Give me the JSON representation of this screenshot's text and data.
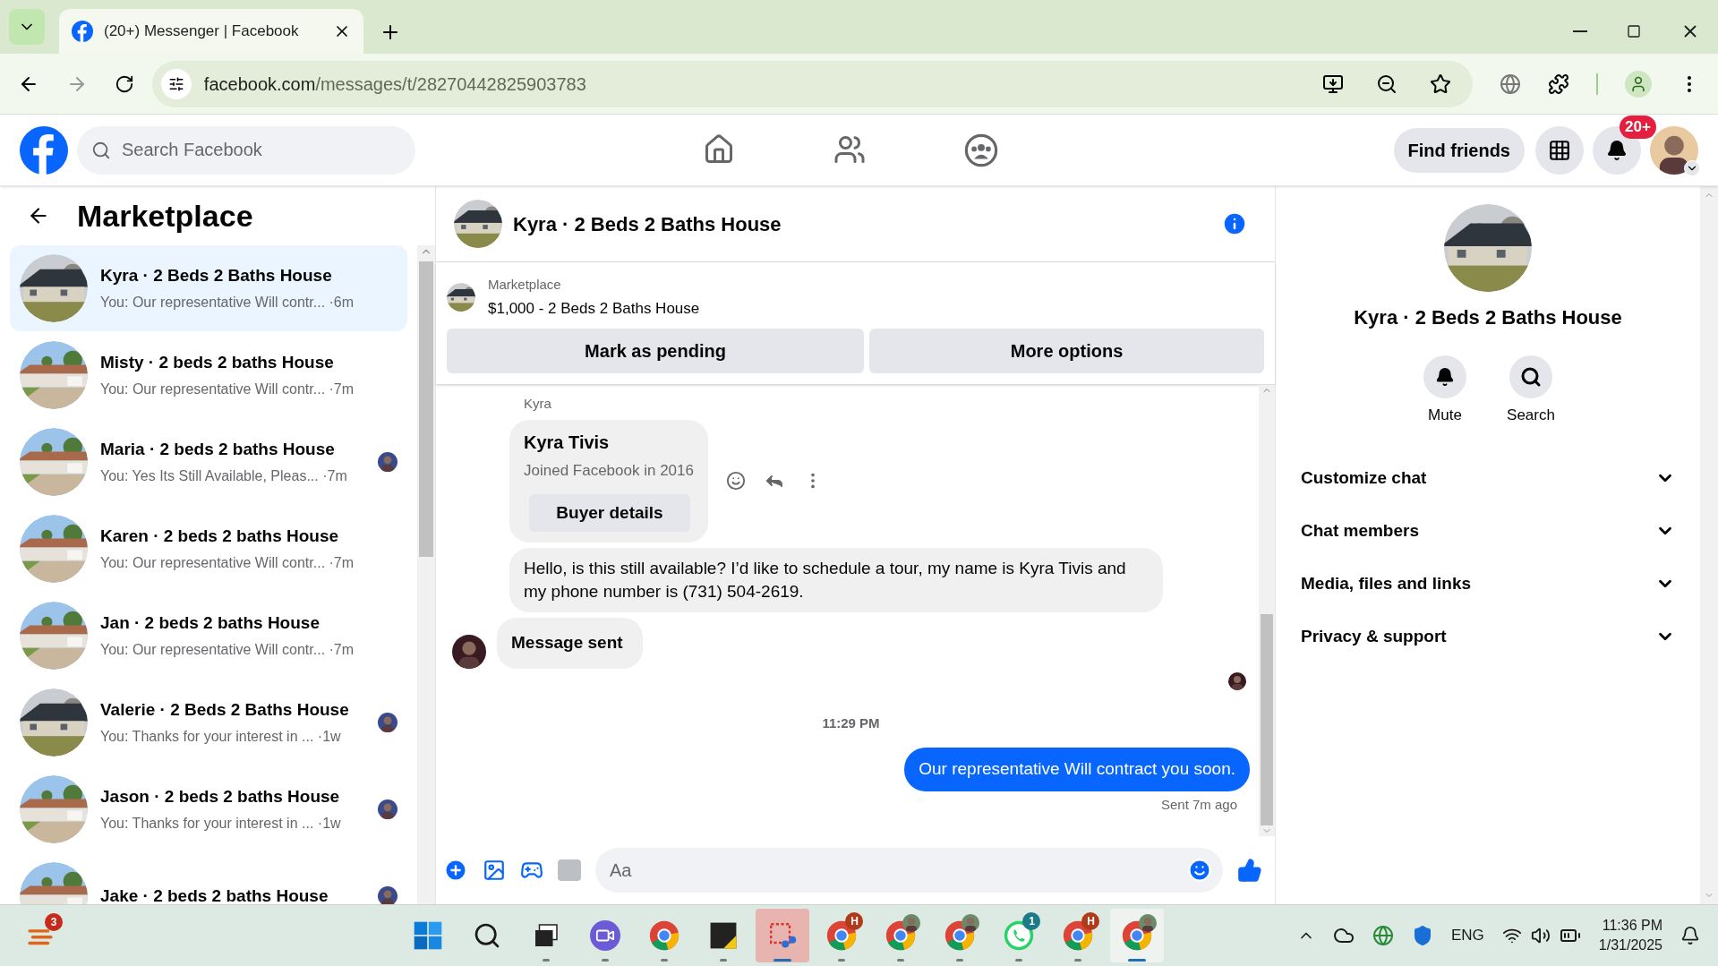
{
  "browser": {
    "tabs": [
      {
        "title": "(20+) Messenger | Facebook",
        "selected": true
      }
    ],
    "url_host": "facebook.com",
    "url_path": "/messages/t/28270442825903783"
  },
  "header": {
    "search_placeholder": "Search Facebook",
    "find_friends": "Find friends",
    "notification_badge": "20+"
  },
  "sidebar": {
    "title": "Marketplace",
    "conversations": [
      {
        "name": "Kyra · 2 Beds 2 Baths House",
        "preview": "You: Our representative Will contr... ·6m",
        "selected": true,
        "seen_avatar": false
      },
      {
        "name": "Misty · 2 beds 2 baths House",
        "preview": "You: Our representative Will contr... ·7m",
        "selected": false,
        "seen_avatar": false
      },
      {
        "name": "Maria · 2 beds 2 baths House",
        "preview": "You: Yes Its Still Available, Pleas... ·7m",
        "selected": false,
        "seen_avatar": true
      },
      {
        "name": "Karen · 2 beds 2 baths House",
        "preview": "You: Our representative Will contr... ·7m",
        "selected": false,
        "seen_avatar": false
      },
      {
        "name": "Jan · 2 beds 2 baths House",
        "preview": "You: Our representative Will contr... ·7m",
        "selected": false,
        "seen_avatar": false
      },
      {
        "name": "Valerie · 2 Beds 2 Baths House",
        "preview": "You: Thanks for your interest in ... ·1w",
        "selected": false,
        "seen_avatar": true
      },
      {
        "name": "Jason · 2 beds 2 baths House",
        "preview": "You: Thanks for your interest in ... ·1w",
        "selected": false,
        "seen_avatar": true
      },
      {
        "name": "Jake · 2 beds 2 baths House",
        "selected": false,
        "seen_avatar": true
      }
    ]
  },
  "chat": {
    "title": "Kyra · 2 Beds 2 Baths House",
    "listing": {
      "source": "Marketplace",
      "title": "$1,000 - 2 Beds 2 Baths House",
      "buttons": [
        "Mark as pending",
        "More options"
      ]
    },
    "sender_label": "Kyra",
    "profile_card": {
      "name": "Kyra Tivis",
      "subtitle": "Joined Facebook in 2016",
      "button": "Buyer details"
    },
    "messages": [
      {
        "kind": "incoming",
        "text": "Hello, is this still available? I’d like to schedule a tour, my name is Kyra Tivis and my phone number is (731) 504-2619."
      },
      {
        "kind": "incoming_bold",
        "text": "Message sent"
      },
      {
        "kind": "timestamp",
        "text": "11:29 PM"
      },
      {
        "kind": "outgoing",
        "text": "Our representative Will contract you soon."
      }
    ],
    "status": "Sent 7m ago",
    "composer_placeholder": "Aa"
  },
  "details": {
    "title": "Kyra · 2 Beds 2 Baths House",
    "actions": [
      "Mute",
      "Search"
    ],
    "sections": [
      {
        "label": "Customize chat",
        "expanded": false
      },
      {
        "label": "Chat members",
        "expanded": false
      },
      {
        "label": "Media, files and links",
        "expanded": false
      },
      {
        "label": "Privacy & support",
        "expanded": false
      }
    ]
  },
  "taskbar": {
    "weather_badge": "3",
    "apps": [
      {
        "kind": "windows"
      },
      {
        "kind": "search"
      },
      {
        "kind": "taskview"
      },
      {
        "kind": "meet"
      },
      {
        "kind": "chrome"
      },
      {
        "kind": "notes"
      },
      {
        "kind": "snip",
        "active": true
      },
      {
        "kind": "chrome",
        "badge": "H"
      },
      {
        "kind": "chrome_avatar"
      },
      {
        "kind": "chrome_avatar"
      },
      {
        "kind": "whatsapp",
        "badge": "1"
      },
      {
        "kind": "chrome",
        "badge": "H"
      },
      {
        "kind": "chrome_avatar",
        "active": true
      }
    ],
    "language": "ENG",
    "time": "11:36 PM",
    "date": "1/31/2025"
  }
}
